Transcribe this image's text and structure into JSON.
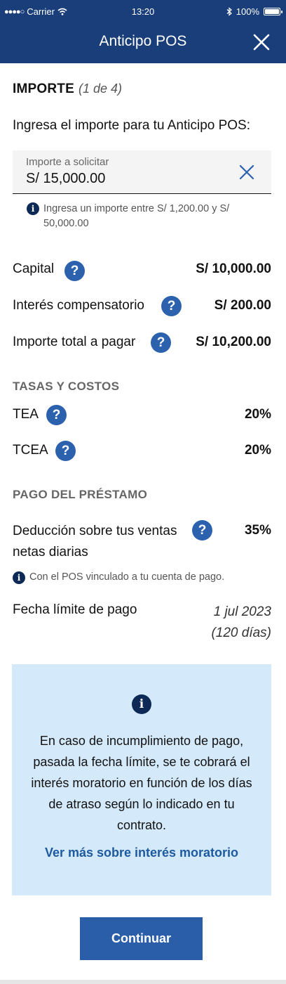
{
  "status_bar": {
    "carrier": "Carrier",
    "time": "13:20",
    "battery": "100%",
    "battery_level": 1.0
  },
  "header": {
    "title": "Anticipo POS",
    "close_icon": "close-icon"
  },
  "step": {
    "title": "IMPORTE",
    "progress": "(1 de 4)"
  },
  "intro_text": "Ingresa el importe para tu Anticipo POS:",
  "amount_input": {
    "label": "Importe a solicitar",
    "value": "S/ 15,000.00",
    "clear_icon": "clear-icon"
  },
  "amount_hint": "Ingresa un importe entre S/ 1,200.00 y S/ 50,000.00",
  "summary": [
    {
      "label": "Capital",
      "value": "S/ 10,000.00"
    },
    {
      "label": "Interés compensatorio",
      "value": "S/ 200.00"
    },
    {
      "label": "Importe total a pagar",
      "value": "S/ 10,200.00"
    }
  ],
  "rates": {
    "title": "TASAS Y COSTOS",
    "items": [
      {
        "label": "TEA",
        "value": "20%"
      },
      {
        "label": "TCEA",
        "value": "20%"
      }
    ]
  },
  "loan_payment": {
    "title": "PAGO DEL PRÉSTAMO",
    "deduction_label": "Deducción sobre tus ventas netas diarias",
    "deduction_value": "35%",
    "note": "Con el POS vinculado a tu cuenta de pago.",
    "due_label": "Fecha límite de pago",
    "due_date": "1 jul 2023",
    "due_days": "(120 días)"
  },
  "notice": {
    "text": "En caso de incumplimiento de pago, pasada la fecha límite, se te cobrará el interés moratorio en función de los días de atraso según lo indicado en tu contrato.",
    "link": "Ver más sobre interés moratorio"
  },
  "cta": {
    "label": "Continuar"
  },
  "colors": {
    "header_bg": "#1a3e7a",
    "accent": "#2c62ad",
    "notice_bg": "#d4e9f9",
    "link": "#1e5aa0"
  }
}
